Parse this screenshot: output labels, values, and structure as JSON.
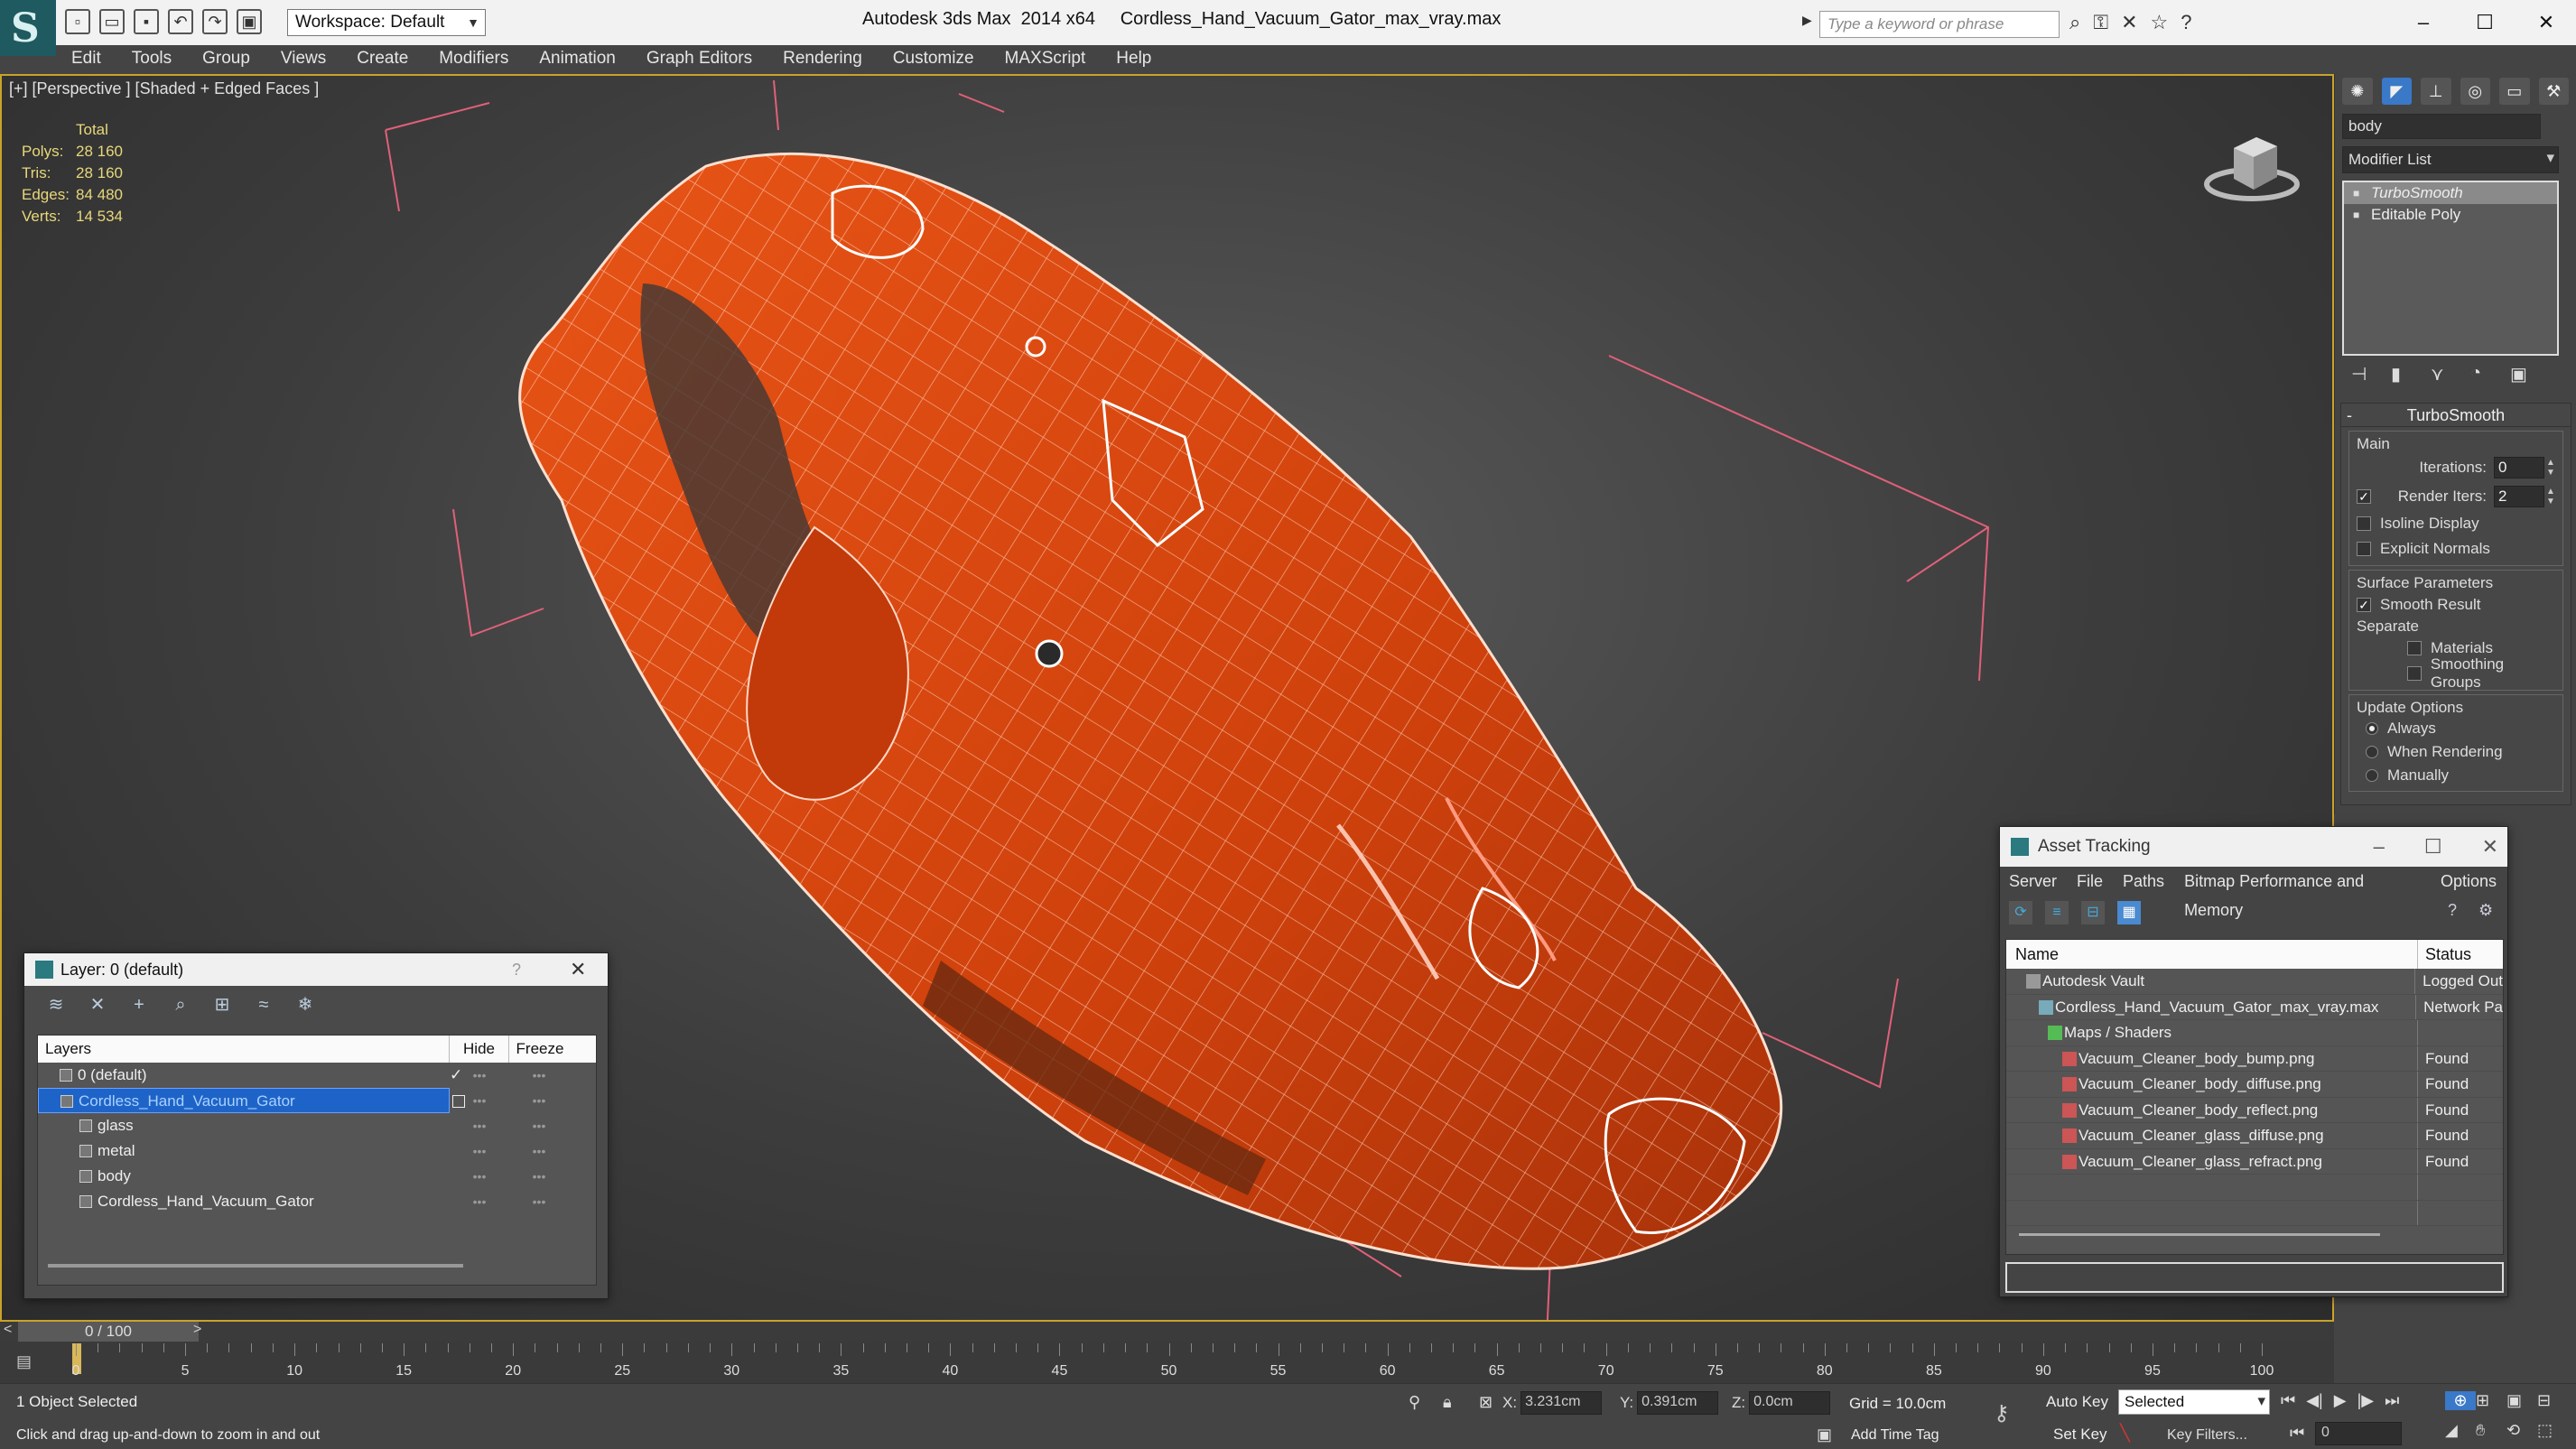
{
  "app": {
    "title": "Autodesk 3ds Max  2014 x64     Cordless_Hand_Vacuum_Gator_max_vray.max",
    "workspace": "Workspace: Default",
    "search_placeholder": "Type a keyword or phrase",
    "logo_letter": "S"
  },
  "menu": [
    "Edit",
    "Tools",
    "Group",
    "Views",
    "Create",
    "Modifiers",
    "Animation",
    "Graph Editors",
    "Rendering",
    "Customize",
    "MAXScript",
    "Help"
  ],
  "viewport": {
    "label": "[+] [Perspective ] [Shaded + Edged Faces ]",
    "stats_header": "Total",
    "stats": [
      {
        "k": "Polys:",
        "v": "28 160"
      },
      {
        "k": "Tris:",
        "v": "28 160"
      },
      {
        "k": "Edges:",
        "v": "84 480"
      },
      {
        "k": "Verts:",
        "v": "14 534"
      }
    ],
    "object_color": "#d84a10",
    "wire_color": "#ffd8c8",
    "bbox_color": "#e0607a"
  },
  "command_panel": {
    "object_name": "body",
    "modifier_list": "Modifier List",
    "stack": [
      "TurboSmooth",
      "Editable Poly"
    ],
    "rollout_title": "TurboSmooth",
    "main_group": "Main",
    "iterations_label": "Iterations:",
    "iterations_value": "0",
    "render_iters_label": "Render Iters:",
    "render_iters_value": "2",
    "isoline_display": "Isoline Display",
    "explicit_normals": "Explicit Normals",
    "surface_group": "Surface Parameters",
    "smooth_result": "Smooth Result",
    "separate": "Separate",
    "materials": "Materials",
    "smoothing_groups": "Smoothing Groups",
    "update_group": "Update Options",
    "always": "Always",
    "when_rendering": "When Rendering",
    "manually": "Manually"
  },
  "layer_window": {
    "title": "Layer: 0 (default)",
    "help": "?",
    "col_layers": "Layers",
    "col_hide": "Hide",
    "col_freeze": "Freeze",
    "rows": [
      {
        "name": "0 (default)",
        "indent": 28
      },
      {
        "name": "Cordless_Hand_Vacuum_Gator",
        "indent": 28
      },
      {
        "name": "glass",
        "indent": 50
      },
      {
        "name": "metal",
        "indent": 50
      },
      {
        "name": "body",
        "indent": 50
      },
      {
        "name": "Cordless_Hand_Vacuum_Gator",
        "indent": 50
      }
    ],
    "check_mark": "✓"
  },
  "asset_window": {
    "title": "Asset Tracking",
    "menu": [
      "Server",
      "File",
      "Paths",
      "Bitmap Performance and Memory",
      "Options"
    ],
    "col_name": "Name",
    "col_status": "Status",
    "rows": [
      {
        "name": "Autodesk Vault",
        "status": "Logged Out",
        "indent": 40
      },
      {
        "name": "Cordless_Hand_Vacuum_Gator_max_vray.max",
        "status": "Network Pa",
        "indent": 54
      },
      {
        "name": "Maps / Shaders",
        "status": "",
        "indent": 64
      },
      {
        "name": "Vacuum_Cleaner_body_bump.png",
        "status": "Found",
        "indent": 80
      },
      {
        "name": "Vacuum_Cleaner_body_diffuse.png",
        "status": "Found",
        "indent": 80
      },
      {
        "name": "Vacuum_Cleaner_body_reflect.png",
        "status": "Found",
        "indent": 80
      },
      {
        "name": "Vacuum_Cleaner_glass_diffuse.png",
        "status": "Found",
        "indent": 80
      },
      {
        "name": "Vacuum_Cleaner_glass_refract.png",
        "status": "Found",
        "indent": 80
      }
    ]
  },
  "timeline": {
    "frame": "0 / 100",
    "labels": [
      "0",
      "5",
      "10",
      "15",
      "20",
      "25",
      "30",
      "35",
      "40",
      "45",
      "50",
      "55",
      "60",
      "65",
      "70",
      "75",
      "80",
      "85",
      "90",
      "95",
      "100"
    ],
    "prev": "<",
    "next": ">"
  },
  "status": {
    "selection": "1 Object Selected",
    "prompt": "Click and drag up-and-down to zoom in and out",
    "x_label": "X:",
    "x_value": "3.231cm",
    "y_label": "Y:",
    "y_value": "0.391cm",
    "z_label": "Z:",
    "z_value": "0.0cm",
    "grid": "Grid = 10.0cm",
    "add_time_tag": "Add Time Tag",
    "auto_key": "Auto Key",
    "set_key": "Set Key",
    "selected": "Selected",
    "key_filters": "Key Filters...",
    "frame_value": "0"
  }
}
